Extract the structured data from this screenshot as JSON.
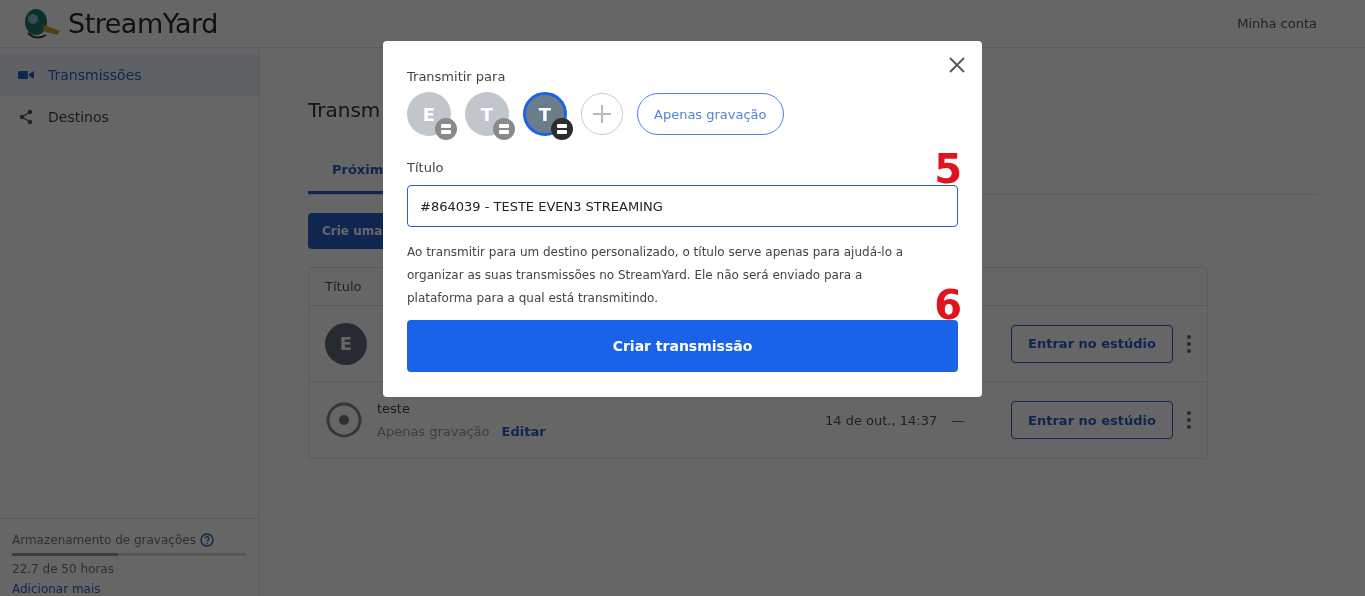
{
  "header": {
    "logo": "StreamYard",
    "account_link": "Minha conta"
  },
  "sidebar": {
    "items": [
      {
        "label": "Transmissões",
        "selected": true
      },
      {
        "label": "Destinos",
        "selected": false
      }
    ],
    "storage": {
      "label": "Armazenamento de gravações",
      "level": 0.454,
      "reading": "22.7 de 50 horas",
      "link": "Adicionar mais"
    }
  },
  "main": {
    "title": "Transm",
    "tabs": [
      {
        "label": "Próxim",
        "selected": true
      }
    ],
    "create_button": "Crie uma",
    "table": {
      "columns": [
        "Título"
      ],
      "rows": [
        {
          "avatar": "E",
          "kind": "avatar",
          "action": "Entrar no estúdio"
        },
        {
          "kind": "recording",
          "title": "teste",
          "subtitle": "Apenas gravação",
          "edit": "Editar",
          "date": "14 de out., 14:37",
          "column_3": "—",
          "action": "Entrar no estúdio"
        }
      ]
    }
  },
  "modal": {
    "destinations_label": "Transmitir para",
    "destinations": [
      {
        "letter": "E",
        "selected": false
      },
      {
        "letter": "T",
        "selected": false
      },
      {
        "letter": "T",
        "selected": true
      }
    ],
    "recording_only_button": "Apenas gravação",
    "title_label": "Título",
    "title_value": "#864039 - TESTE EVEN3 STREAMING",
    "help_text": "Ao transmitir para um destino personalizado, o título serve apenas para ajudá-lo a organizar as suas transmissões no StreamYard. Ele não será enviado para a plataforma para a qual está transmitindo.",
    "submit_button": "Criar transmissão"
  },
  "annotations": [
    "5",
    "6"
  ]
}
